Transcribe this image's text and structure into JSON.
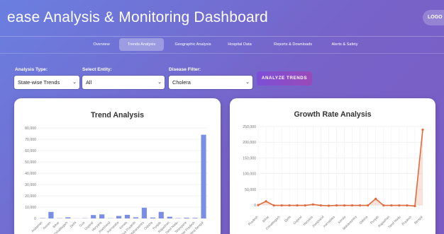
{
  "header": {
    "title": "ease Analysis & Monitoring Dashboard",
    "logout_label": "LOGO"
  },
  "tabs": [
    {
      "label": "Overview",
      "active": false
    },
    {
      "label": "Trends Analysis",
      "active": true
    },
    {
      "label": "Geographic Analysis",
      "active": false
    },
    {
      "label": "Hospital Data",
      "active": false
    },
    {
      "label": "Reports & Downloads",
      "active": false
    },
    {
      "label": "Alerts & Safety",
      "active": false
    }
  ],
  "filters": {
    "analysis_type_label": "Analysis Type:",
    "analysis_type_value": "State-wise Trends",
    "entity_label": "Select Entity:",
    "entity_value": "All",
    "disease_label": "Disease Filter:",
    "disease_value": "Cholera",
    "analyze_label": "ANALYZE TRENDS"
  },
  "colors": {
    "accent": "#7c4fd6",
    "bar": "#7b8ee6",
    "line": "#e06a3c"
  },
  "chart_data": [
    {
      "type": "bar",
      "title": "Trend Analysis",
      "ylim": [
        0,
        80000
      ],
      "yticks": [
        "0",
        "10,000",
        "20,000",
        "30,000",
        "40,000",
        "50,000",
        "60,000",
        "70,000",
        "80,000"
      ],
      "xticklabels": [
        "Andaman",
        "Assam",
        "Bihar",
        "Chhattisgarh",
        "Delhi",
        "Goa",
        "Gujarat",
        "Haryana",
        "Jharkhand",
        "Karnataka",
        "Kerala",
        "Madhya Pradesh",
        "Maharashtra",
        "Odisha",
        "Punjab",
        "Rajasthan",
        "Tamil Nadu",
        "Telangana",
        "Uttar Pradesh",
        "West Bengal"
      ],
      "values": [
        300,
        5800,
        200,
        1000,
        100,
        200,
        3000,
        3600,
        200,
        2200,
        3200,
        1000,
        9500,
        800,
        5800,
        1500,
        300,
        600,
        500,
        74000
      ],
      "grid": true
    },
    {
      "type": "line",
      "title": "Growth Rate Analysis",
      "ylim": [
        -20000,
        250000
      ],
      "yticks": [
        "0",
        "50,000",
        "100,000",
        "150,000",
        "200,000",
        "250,000"
      ],
      "ytick_values": [
        0,
        50000,
        100000,
        150000,
        200000,
        250000
      ],
      "xticklabels": [
        "Pradesh",
        "Bihar",
        "Chhattisgarh",
        "Delhi",
        "Gujarat",
        "Haryana",
        "Jharkhand",
        "Karnataka",
        "Kerala",
        "Maharashtra",
        "Odisha",
        "Punjab",
        "Rajasthan",
        "Tamil Nadu",
        "Pradesh",
        "Bengal"
      ],
      "values": [
        0,
        12000,
        -1000,
        -1000,
        -1000,
        -1000,
        -1000,
        2000,
        -1000,
        -2000,
        -1000,
        -1000,
        -1000,
        -1000,
        -1000,
        20000,
        -1000,
        -1000,
        -1000,
        -1000,
        -3000,
        240000
      ],
      "grid": true
    }
  ]
}
